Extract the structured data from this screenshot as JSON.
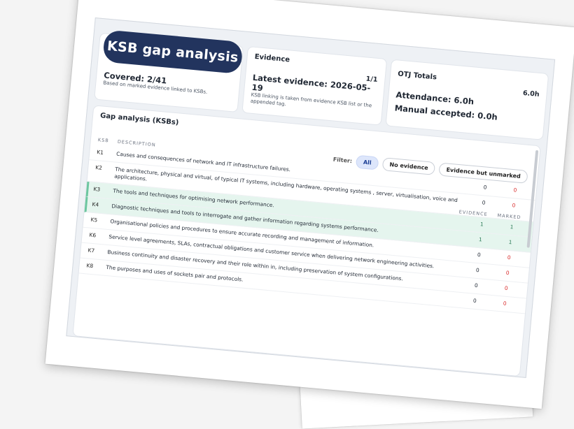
{
  "summary": {
    "title": "KSB gap analysis",
    "covered": "Covered: 2/41",
    "covered_note": "Based on marked evidence linked to KSBs."
  },
  "evidence": {
    "heading": "Evidence",
    "count": "1/1",
    "latest": "Latest evidence: 2026-05-19",
    "note": "KSB linking is taken from evidence KSB list or the appended tag."
  },
  "otj": {
    "heading": "OTJ Totals",
    "total": "6.0h",
    "attendance": "Attendance: 6.0h",
    "manual": "Manual accepted: 0.0h"
  },
  "gap": {
    "heading": "Gap analysis (KSBs)",
    "filter_label": "Filter:",
    "filters": [
      "All",
      "No evidence",
      "Evidence but unmarked"
    ],
    "columns": {
      "ksb": "KSB",
      "description": "Description",
      "evidence": "Evidence",
      "marked": "Marked"
    },
    "rows": [
      {
        "ksb": "K1",
        "description": "Causes and consequences of network and IT infrastructure failures.",
        "evidence": "0",
        "marked": "0",
        "highlight": false
      },
      {
        "ksb": "K2",
        "description": "The architecture, physical and virtual, of typical IT systems, including hardware, operating systems , server, virtualisation, voice and applications.",
        "evidence": "0",
        "marked": "0",
        "highlight": false
      },
      {
        "ksb": "K3",
        "description": "The tools and techniques for optimising network performance.",
        "evidence": "1",
        "marked": "1",
        "highlight": true
      },
      {
        "ksb": "K4",
        "description": "Diagnostic techniques and tools to interrogate and gather information regarding systems performance.",
        "evidence": "1",
        "marked": "1",
        "highlight": true
      },
      {
        "ksb": "K5",
        "description": "Organisational policies and procedures to ensure accurate recording and management of information.",
        "evidence": "0",
        "marked": "0",
        "highlight": false
      },
      {
        "ksb": "K6",
        "description": "Service level agreements, SLAs, contractual obligations and customer service when delivering network engineering activities.",
        "evidence": "0",
        "marked": "0",
        "highlight": false
      },
      {
        "ksb": "K7",
        "description": "Business continuity and disaster recovery and their role within in, including preservation of system configurations.",
        "evidence": "0",
        "marked": "0",
        "highlight": false
      },
      {
        "ksb": "K8",
        "description": "The purposes and uses of sockets pair and protocols.",
        "evidence": "0",
        "marked": "0",
        "highlight": false
      }
    ]
  }
}
